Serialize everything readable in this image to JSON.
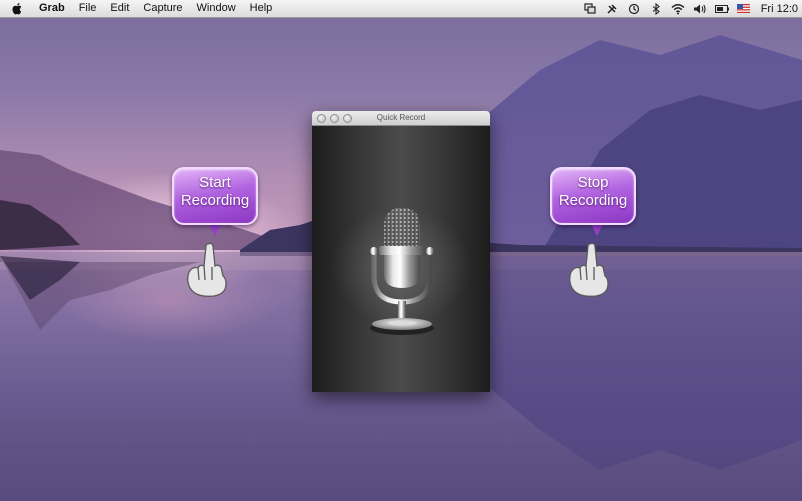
{
  "menubar": {
    "app_name": "Grab",
    "items": [
      "File",
      "Edit",
      "Capture",
      "Window",
      "Help"
    ],
    "clock": "Fri 12:0"
  },
  "window": {
    "title": "Quick Record"
  },
  "callouts": {
    "start": "Start\nRecording",
    "stop": "Stop\nRecording"
  }
}
